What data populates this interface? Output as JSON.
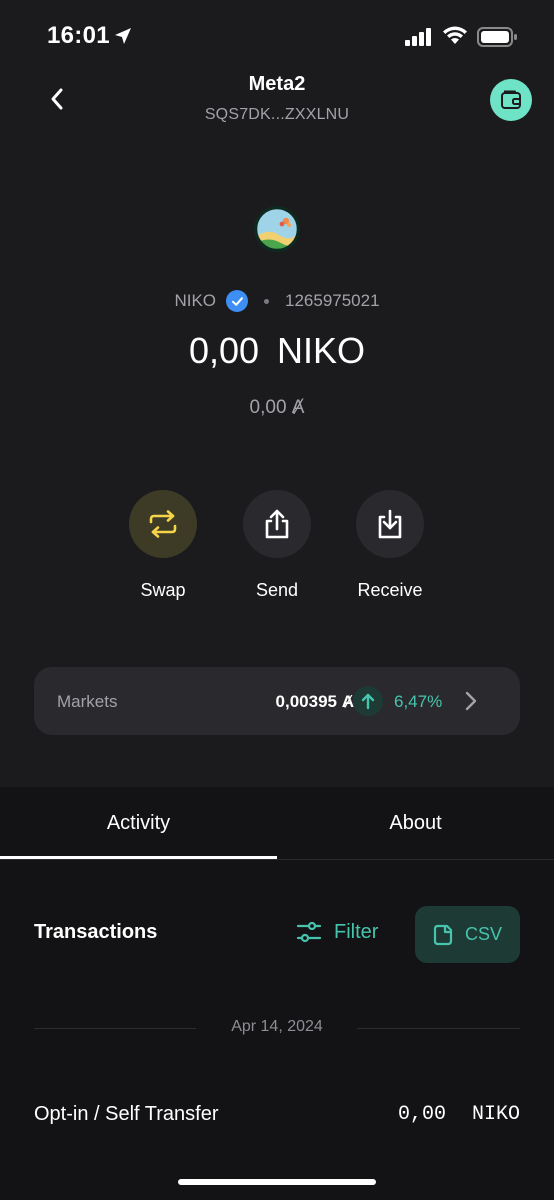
{
  "status_bar": {
    "time": "16:01"
  },
  "header": {
    "title": "Meta2",
    "address": "SQS7DK...ZXXLNU"
  },
  "asset": {
    "name": "NIKO",
    "id": "1265975021",
    "amount": "0,00 NIKO",
    "algo_value": "0,00 Ⱥ"
  },
  "actions": [
    {
      "label": "Swap",
      "icon": "swap-icon"
    },
    {
      "label": "Send",
      "icon": "send-icon"
    },
    {
      "label": "Receive",
      "icon": "receive-icon"
    }
  ],
  "markets": {
    "label": "Markets",
    "price": "0,00395 Ⱥ",
    "change": "6,47%",
    "direction_icon": "arrow-up-icon"
  },
  "tabs": [
    {
      "label": "Activity",
      "active": true
    },
    {
      "label": "About",
      "active": false
    }
  ],
  "transactions": {
    "title": "Transactions",
    "filter_label": "Filter",
    "csv_label": "CSV",
    "groups": [
      {
        "date": "Apr 14, 2024",
        "items": [
          {
            "description": "Opt-in / Self Transfer",
            "amount": "0,00 NIKO"
          }
        ]
      }
    ]
  },
  "colors": {
    "background": "#1b1b1e",
    "accent_teal": "#46c4ae",
    "wallet_button": "#6fe3c6",
    "swap_yellow": "#f5d44a",
    "verified_blue": "#3d8ef5"
  }
}
